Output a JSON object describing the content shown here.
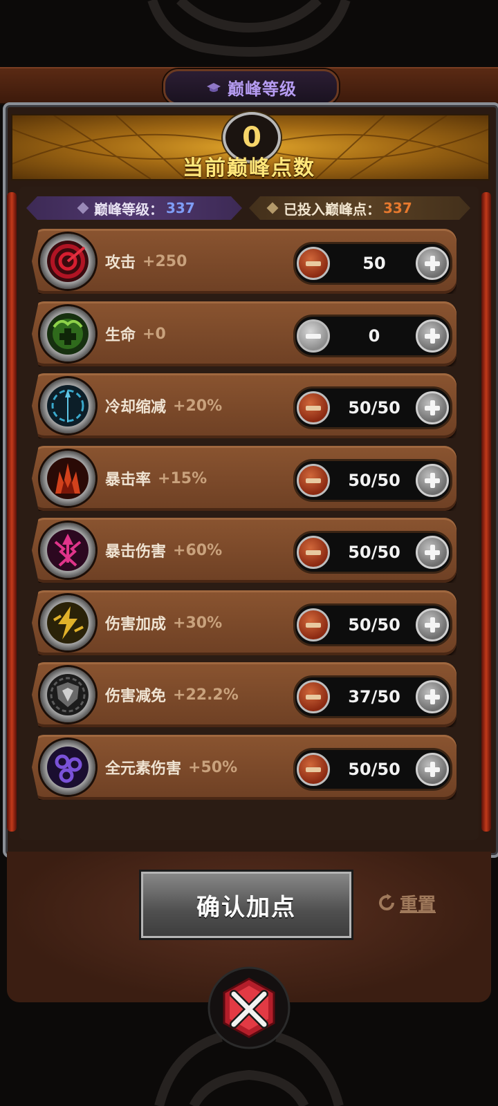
{
  "header": {
    "title": "巅峰等级",
    "icon": "graduation-cap-icon",
    "title_color": "#b69cf2"
  },
  "banner": {
    "points": "0",
    "label": "当前巅峰点数"
  },
  "summary": {
    "level_label": "巅峰等级：",
    "level_value": "337",
    "invested_label": "已投入巅峰点：",
    "invested_value": "337"
  },
  "stats": [
    {
      "name": "攻击",
      "bonus": "+250",
      "value": "50",
      "icon": "attack-target-icon",
      "minus_enabled": true
    },
    {
      "name": "生命",
      "bonus": "+0",
      "value": "0",
      "icon": "life-cross-icon",
      "minus_enabled": false
    },
    {
      "name": "冷却缩减",
      "bonus": "+20%",
      "value": "50/50",
      "icon": "cooldown-clock-icon",
      "minus_enabled": true
    },
    {
      "name": "暴击率",
      "bonus": "+15%",
      "value": "50/50",
      "icon": "crit-rate-flame-icon",
      "minus_enabled": true
    },
    {
      "name": "暴击伤害",
      "bonus": "+60%",
      "value": "50/50",
      "icon": "crit-damage-arrows-icon",
      "minus_enabled": true
    },
    {
      "name": "伤害加成",
      "bonus": "+30%",
      "value": "50/50",
      "icon": "damage-bonus-lightning-icon",
      "minus_enabled": true
    },
    {
      "name": "伤害减免",
      "bonus": "+22.2%",
      "value": "37/50",
      "icon": "damage-reduction-shield-icon",
      "minus_enabled": true
    },
    {
      "name": "全元素伤害",
      "bonus": "+50%",
      "value": "50/50",
      "icon": "all-element-orbs-icon",
      "minus_enabled": true
    }
  ],
  "footer": {
    "confirm_label": "确认加点",
    "reset_label": "重置",
    "close_icon": "close-icon"
  }
}
